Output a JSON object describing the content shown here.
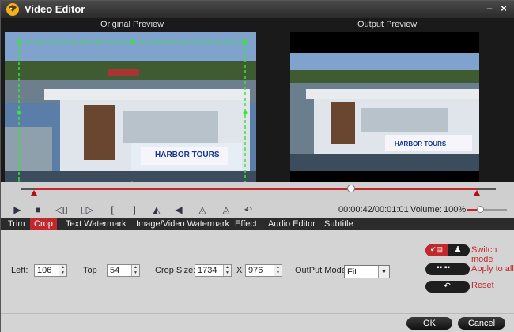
{
  "window": {
    "title": "Video Editor",
    "minimize_label": "–",
    "close_label": "×"
  },
  "preview": {
    "original_label": "Original Preview",
    "output_label": "Output Preview",
    "sign_text": "HARBOR TOURS"
  },
  "playback": {
    "time": "00:00:42/00:01:01",
    "volume_label": "Volume:",
    "volume_value": "100%",
    "volume_level": 1.0,
    "position_fraction": 0.69
  },
  "tabs": [
    {
      "label": "Trim",
      "active": false
    },
    {
      "label": "Crop",
      "active": true
    },
    {
      "label": "Text Watermark",
      "active": false
    },
    {
      "label": "Image/Video Watermark",
      "active": false
    },
    {
      "label": "Effect",
      "active": false
    },
    {
      "label": "Audio Editor",
      "active": false
    },
    {
      "label": "Subtitle",
      "active": false
    }
  ],
  "crop": {
    "left_label": "Left:",
    "left_value": "106",
    "top_label": "Top",
    "top_value": "54",
    "size_label": "Crop Size:",
    "width_value": "1734",
    "x_label": "X",
    "height_value": "976",
    "mode_label": "OutPut Mode",
    "mode_value": "Fit"
  },
  "side": {
    "switch_mode": "Switch mode",
    "apply_all": "Apply to all",
    "reset": "Reset"
  },
  "footer": {
    "ok": "OK",
    "cancel": "Cancel"
  },
  "colors": {
    "accent": "#c0282b",
    "crop_box": "#37e637"
  }
}
